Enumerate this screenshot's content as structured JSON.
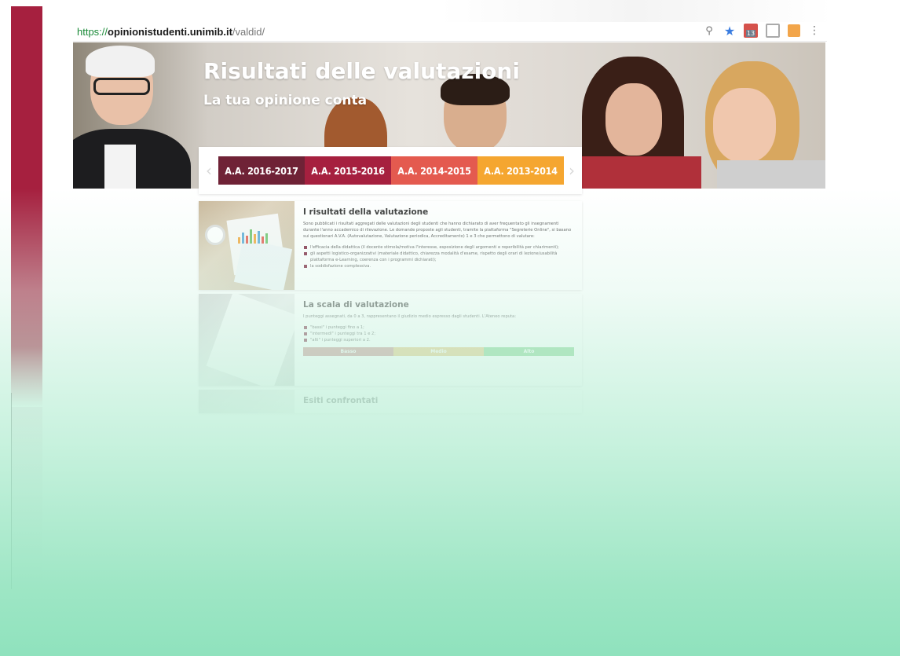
{
  "browser": {
    "url_scheme": "https://",
    "url_host": "opinionistudenti.unimib.it",
    "url_path": "/valdid/",
    "calendar_badge": "13"
  },
  "hero": {
    "title": "Risultati delle valutazioni",
    "subtitle": "La tua opinione conta"
  },
  "tabs": [
    {
      "label": "A.A. 2016-2017",
      "color": "#6f2236"
    },
    {
      "label": "A.A. 2015-2016",
      "color": "#a6203f"
    },
    {
      "label": "A.A. 2014-2015",
      "color": "#e45a4f"
    },
    {
      "label": "A.A. 2013-2014",
      "color": "#f5a630"
    }
  ],
  "sections": {
    "results": {
      "title": "I risultati della valutazione",
      "intro": "Sono pubblicati i risultati aggregati delle valutazioni degli studenti che hanno dichiarato di aver frequentato gli insegnamenti durante l'anno accademico di rilevazione. Le domande proposte agli studenti, tramite la piattaforma \"Segreterie Online\", si basano sui questionari A.V.A. (Autovalutazione, Valutazione periodica, Accreditamento) 1 e 3 che permettono di valutare:",
      "bullets": [
        "l'efficacia della didattica (il docente stimola/motiva l'interesse, esposizione degli argomenti e reperibilità per chiarimenti);",
        "gli aspetti logistico-organizzativi (materiale didattico, chiarezza modalità d'esame, rispetto degli orari di lezione/usabilità piattaforma e-Learning, coerenza con i programmi dichiarati);",
        "la soddisfazione complessiva."
      ]
    },
    "scale": {
      "title": "La scala di valutazione",
      "intro": "I punteggi assegnati, da 0 a 3, rappresentano il giudizio medio espresso dagli studenti. L'Ateneo reputa:",
      "bullets": [
        "\"bassi\" i punteggi fino a 1;",
        "\"intermedi\" i punteggi tra 1 e 2;",
        "\"alti\" i punteggi superiori a 2."
      ],
      "scale_labels": [
        "Basso",
        "Medio",
        "Alto"
      ]
    },
    "third": {
      "title": "Esiti confrontati"
    }
  }
}
